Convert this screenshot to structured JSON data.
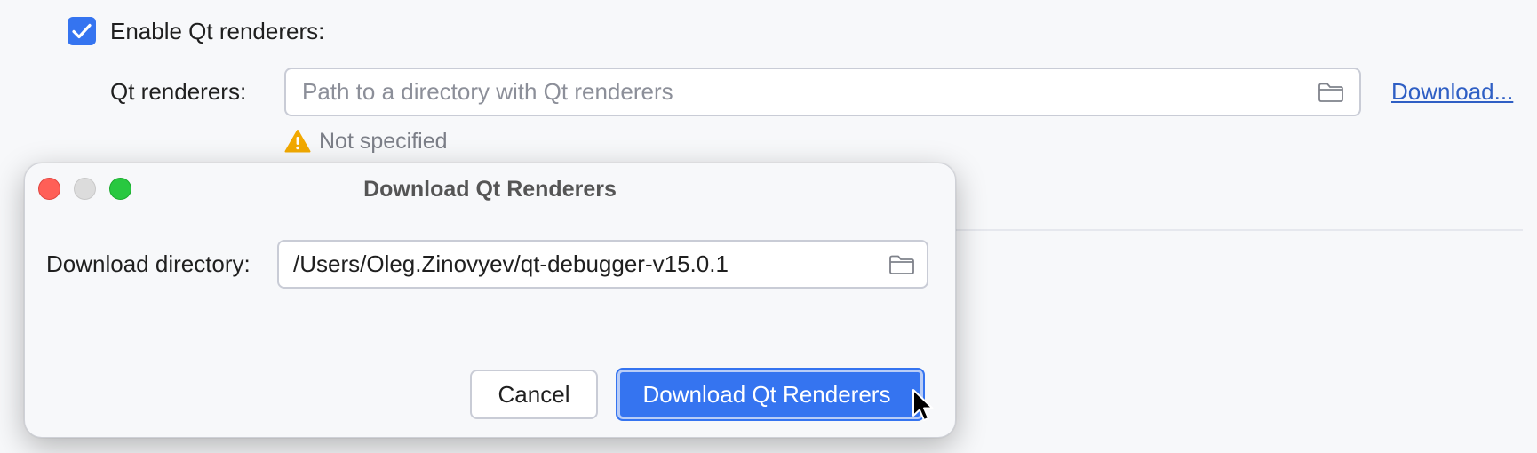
{
  "settings": {
    "enable_checkbox": {
      "label": "Enable Qt renderers:",
      "checked": true
    },
    "renderers_label": "Qt renderers:",
    "renderers_field": {
      "value": "",
      "placeholder": "Path to a directory with Qt renderers"
    },
    "download_link": "Download...",
    "warning_text": "Not specified"
  },
  "dialog": {
    "title": "Download Qt Renderers",
    "dir_label": "Download directory:",
    "dir_value": "/Users/Oleg.Zinovyev/qt-debugger-v15.0.1",
    "cancel_label": "Cancel",
    "confirm_label": "Download Qt Renderers"
  },
  "icons": {
    "checkbox": "checkmark-icon",
    "folder": "folder-icon",
    "warning": "warning-triangle-icon",
    "cursor": "mouse-pointer-icon"
  },
  "colors": {
    "accent": "#3574f0",
    "link": "#2f5fc4",
    "warning": "#f2a900",
    "traffic_close": "#ff5f57",
    "traffic_minimize": "#dcdcdc",
    "traffic_zoom": "#28c840"
  }
}
